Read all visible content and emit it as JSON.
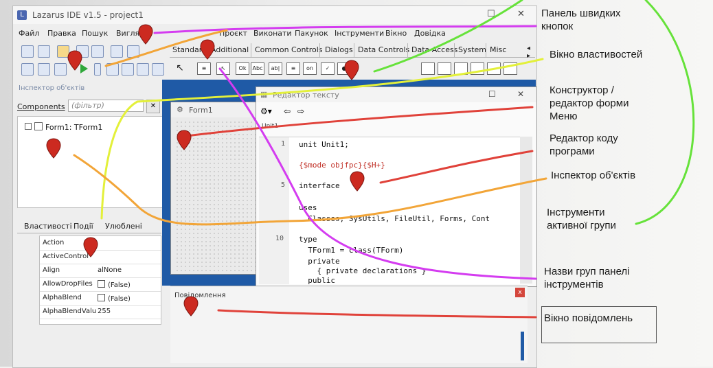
{
  "window": {
    "title": "Lazarus IDE v1.5 - project1"
  },
  "menu": [
    "Файл",
    "Правка",
    "Пошук",
    "Вигляд",
    "Проєкт",
    "Виконати",
    "Пакунок",
    "Інструменти",
    "Вікно",
    "Довідка"
  ],
  "palette_tabs": [
    "Standard",
    "Additional",
    "Common Controls",
    "Dialogs",
    "Data Controls",
    "Data Access",
    "System",
    "Misc"
  ],
  "palette_icon_labels": [
    "Ok",
    "Abc",
    "ab|",
    "on"
  ],
  "inspector": {
    "title": "Інспектор об'єктів",
    "components_label": "Components",
    "filter_placeholder": "(фільтр)",
    "tree_root": "Form1: TForm1",
    "tabs": [
      "Властивості",
      "Події",
      "Улюблені"
    ],
    "properties": [
      {
        "name": "Action",
        "value": ""
      },
      {
        "name": "ActiveControl",
        "value": ""
      },
      {
        "name": "Align",
        "value": "alNone"
      },
      {
        "name": "AllowDropFiles",
        "value": "(False)"
      },
      {
        "name": "AlphaBlend",
        "value": "(False)"
      },
      {
        "name": "AlphaBlendValu",
        "value": "255"
      }
    ]
  },
  "form": {
    "title": "Form1"
  },
  "editor": {
    "title": "Редактор тексту",
    "tab": "Unit1",
    "lines": [
      {
        "num": "1",
        "text": "unit Unit1;"
      },
      {
        "num": "",
        "text": "{$mode objfpc}{$H+}"
      },
      {
        "num": "5",
        "text": "interface"
      },
      {
        "num": "",
        "text": "uses"
      },
      {
        "num": "",
        "text": "  Classes, SysUtils, FileUtil, Forms, Cont"
      },
      {
        "num": "10",
        "text": "type"
      },
      {
        "num": "",
        "text": "  TForm1 = class(TForm)"
      },
      {
        "num": "",
        "text": "  private"
      },
      {
        "num": "",
        "text": "    { private declarations }"
      },
      {
        "num": "",
        "text": "  public"
      }
    ]
  },
  "messages": {
    "title": "Повідомлення"
  },
  "annotations": {
    "quick_buttons": [
      "Панель швидких",
      "кнопок"
    ],
    "properties_window": "Вікно властивостей",
    "form_designer": [
      "Конструктор /",
      "редактор форми",
      "Меню"
    ],
    "code_editor": [
      "Редактор коду",
      "програми"
    ],
    "object_inspector": "Інспектор об'єктів",
    "active_group_tools": [
      "Інструменти",
      "активної групи"
    ],
    "palette_group_names": [
      "Назви груп панелі",
      "інструментів"
    ],
    "messages_window": [
      "Вікно повідомлень"
    ]
  },
  "colors": {
    "arrow_magenta": "#d43cf0",
    "arrow_green": "#66e23a",
    "arrow_yellow": "#e3f03a",
    "arrow_orange": "#f2a538",
    "arrow_red": "#e0423a",
    "pin_red": "#cc2a20",
    "ide_blue": "#1f5aa6"
  }
}
